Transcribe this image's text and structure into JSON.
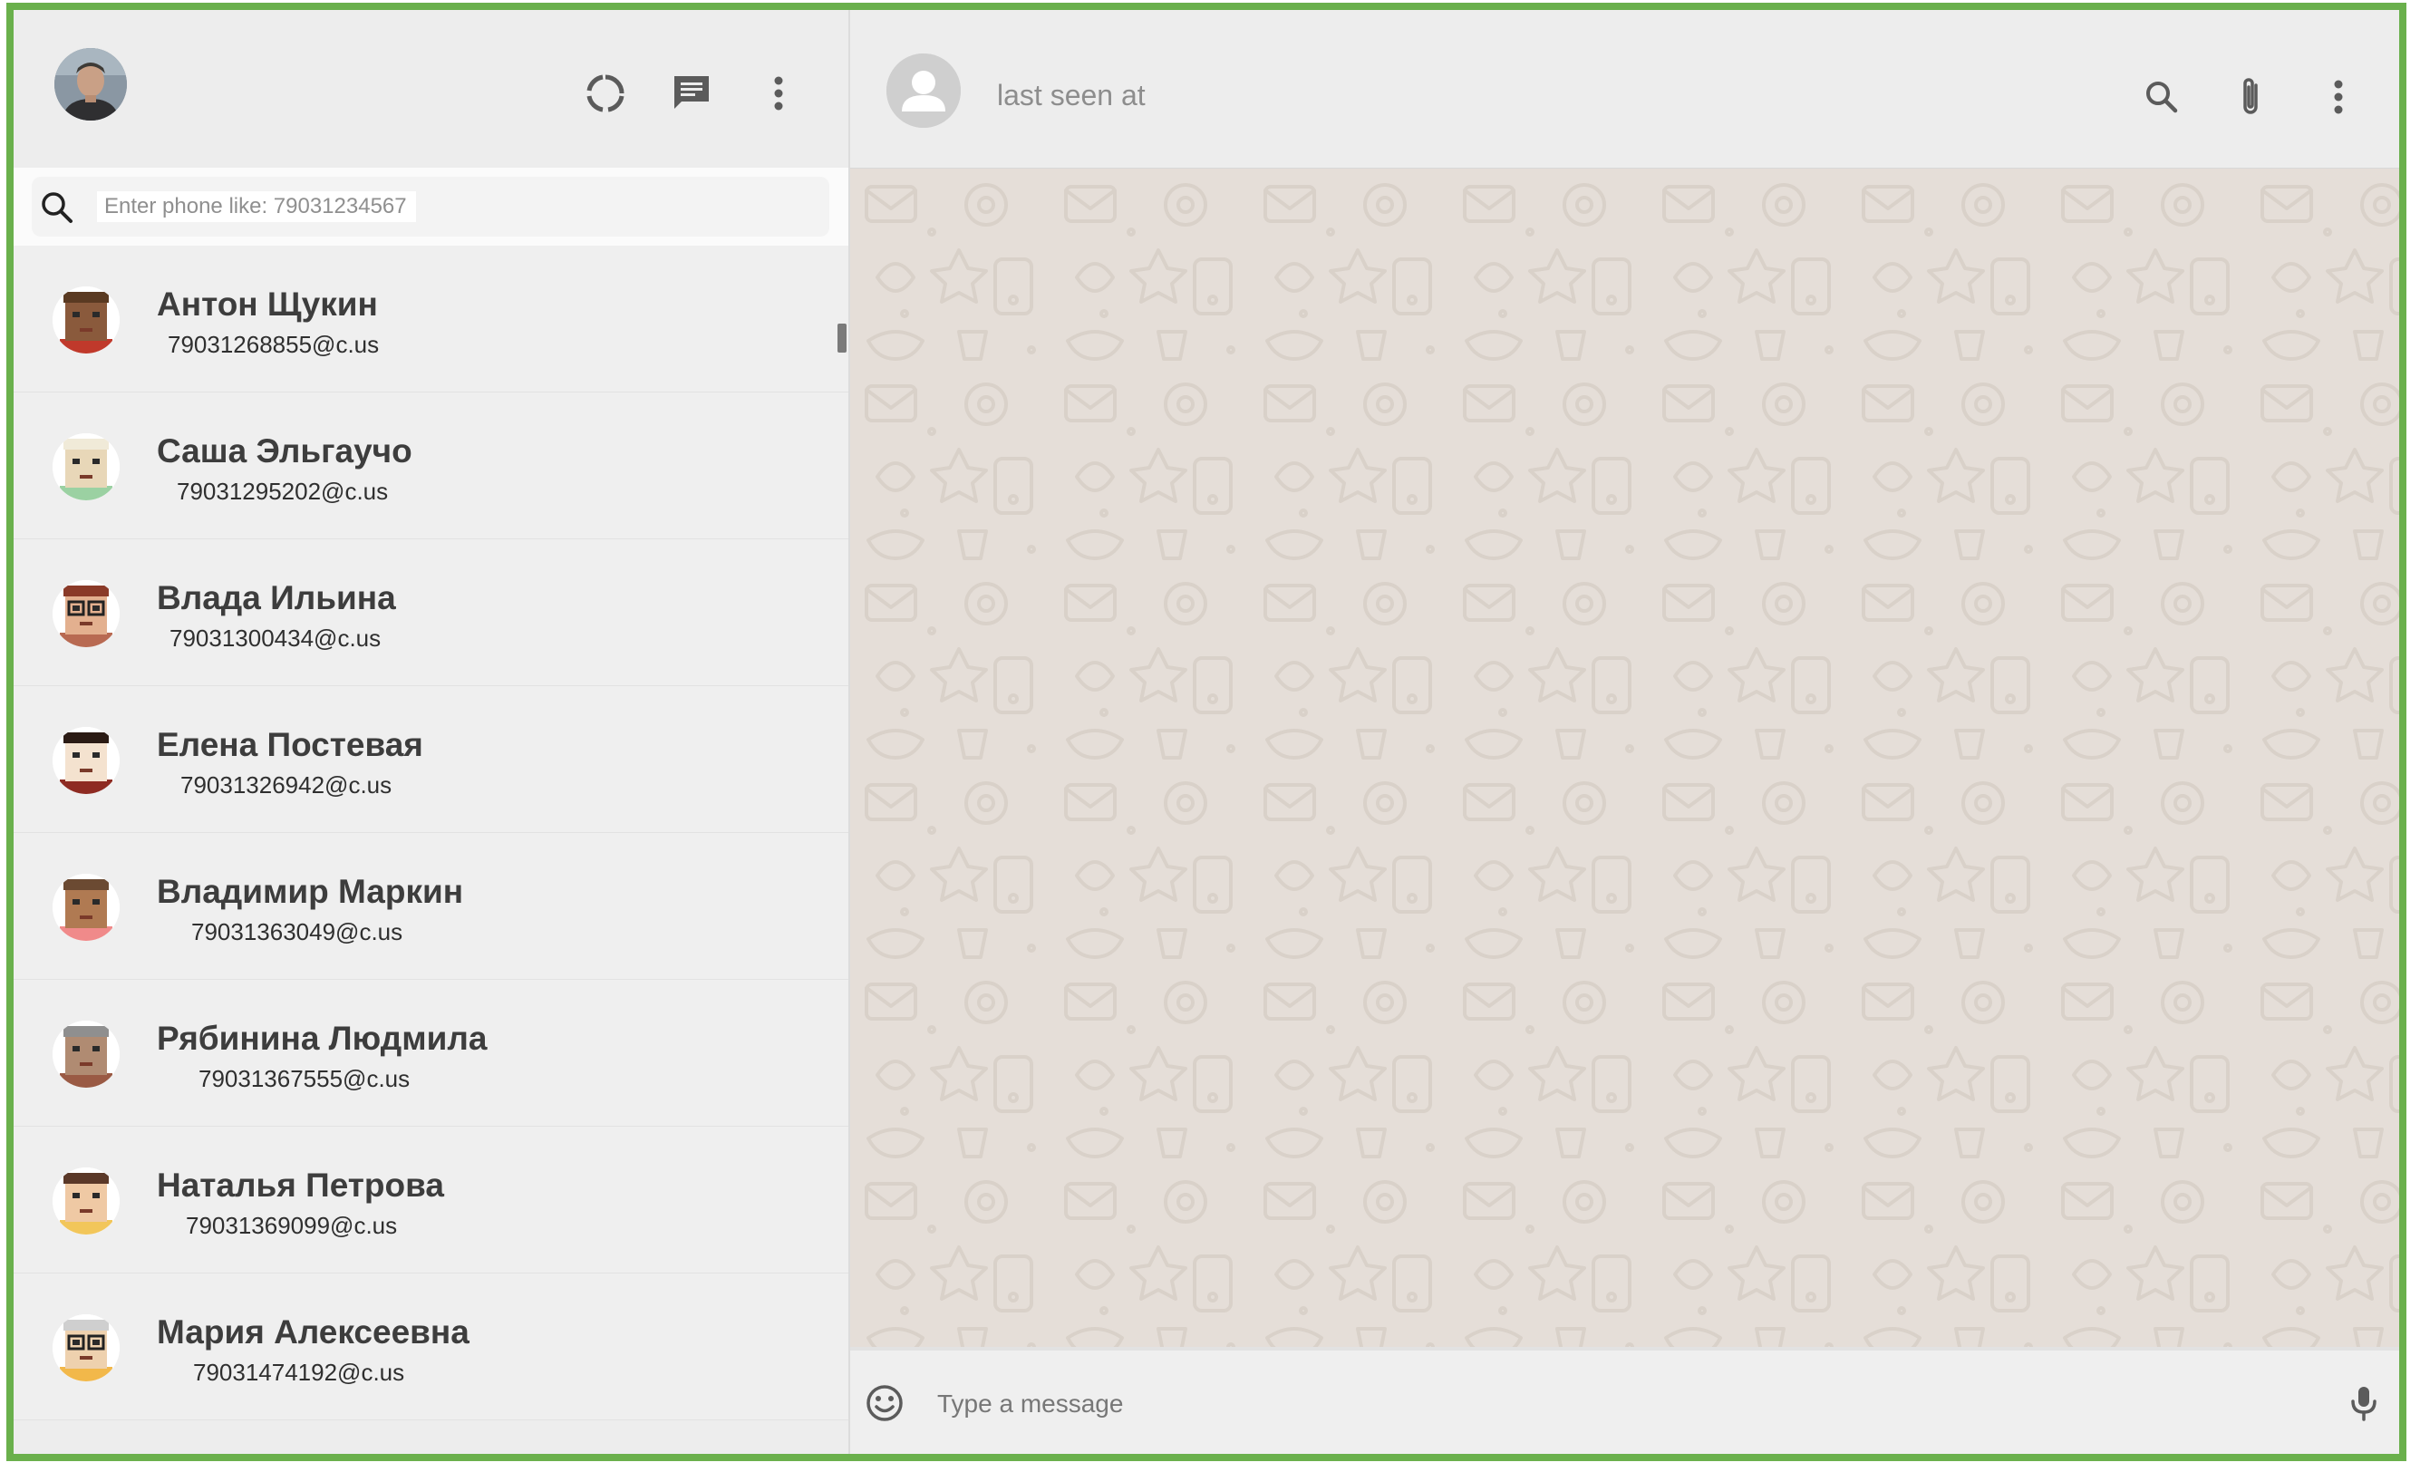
{
  "header": {
    "icons": [
      "status-icon",
      "new-chat-icon",
      "menu-icon"
    ]
  },
  "search": {
    "placeholder": "Enter phone like: 79031234567",
    "value": ""
  },
  "contacts": [
    {
      "name": "Антон Щукин",
      "phone": "79031268855@c.us"
    },
    {
      "name": "Саша Эльгаучо",
      "phone": "79031295202@c.us"
    },
    {
      "name": "Влада Ильина",
      "phone": "79031300434@c.us"
    },
    {
      "name": "Елена Постевая",
      "phone": "79031326942@c.us"
    },
    {
      "name": "Владимир Маркин",
      "phone": "79031363049@c.us"
    },
    {
      "name": "Рябинина Людмила",
      "phone": "79031367555@c.us"
    },
    {
      "name": "Наталья Петрова",
      "phone": "79031369099@c.us"
    },
    {
      "name": "Мария Алексеевна",
      "phone": "79031474192@c.us"
    }
  ],
  "chat": {
    "last_seen": "last seen at",
    "icons": [
      "search-icon",
      "attach-icon",
      "menu-icon"
    ]
  },
  "composer": {
    "placeholder": "Type a message",
    "value": ""
  },
  "colors": {
    "frame": "#6ab04c",
    "panel": "#ededed",
    "chat_background": "#e5ded8"
  }
}
